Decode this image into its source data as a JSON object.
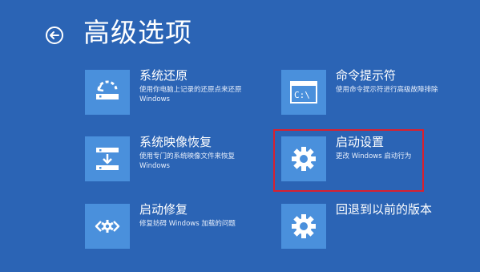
{
  "header": {
    "title": "高级选项",
    "back_icon": "back-arrow-icon"
  },
  "options": [
    {
      "id": "system-restore",
      "title": "系统还原",
      "description": "使用你电脑上记录的还原点来还原 Windows",
      "icon": "restore-icon"
    },
    {
      "id": "command-prompt",
      "title": "命令提示符",
      "description": "使用命令提示符进行高级故障排除",
      "icon": "cmd-window-icon"
    },
    {
      "id": "system-image-recovery",
      "title": "系统映像恢复",
      "description": "使用专门的系统映像文件来恢复 Windows",
      "icon": "image-recovery-icon"
    },
    {
      "id": "startup-settings",
      "title": "启动设置",
      "description": "更改 Windows 启动行为",
      "icon": "gear-icon",
      "highlighted": true
    },
    {
      "id": "startup-repair",
      "title": "启动修复",
      "description": "修复妨碍 Windows 加载的问题",
      "icon": "startup-repair-icon"
    },
    {
      "id": "go-back-previous",
      "title": "回退到以前的版本",
      "description": "",
      "icon": "gear-icon"
    }
  ],
  "colors": {
    "background": "#2b64b5",
    "tile": "#4a90dc",
    "highlight": "#d9202f"
  }
}
